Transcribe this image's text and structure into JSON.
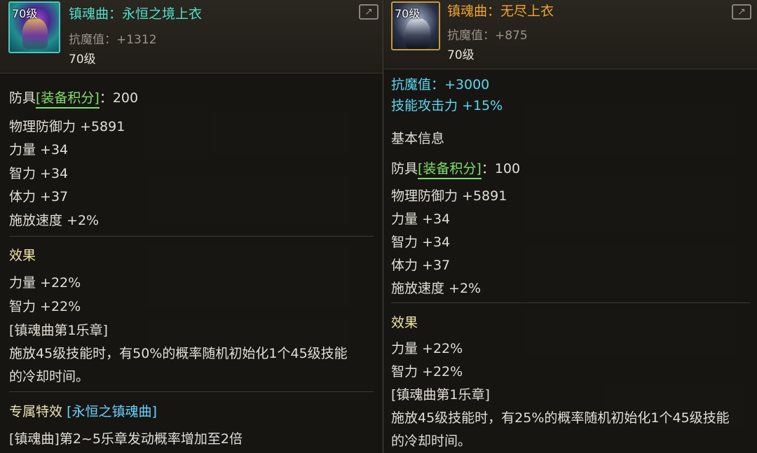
{
  "left": {
    "icon_level": "70级",
    "icon": "armor-icon",
    "title": "镇魂曲：永恒之境上衣",
    "magic_res": "抗魔值：+1312",
    "level": "70级",
    "armor_prefix": "防具",
    "score_label": "[装备积分]",
    "score_value": "：200",
    "stats": [
      "物理防御力 +5891",
      "力量 +34",
      "智力 +34",
      "体力 +37",
      "施放速度 +2%"
    ],
    "effect_title": "效果",
    "effects": [
      "力量 +22%",
      "智力 +22%",
      "[镇魂曲第1乐章]",
      "施放45级技能时，有50%的概率随机初始化1个45级技能",
      "的冷却时间。"
    ],
    "exclusive_title": "专属特效",
    "exclusive_name": "[永恒之镇魂曲]",
    "exclusive_desc": "[镇魂曲]第2~5乐章发动概率增加至2倍"
  },
  "right": {
    "icon_level": "70级",
    "icon": "armor-icon",
    "title": "镇魂曲：无尽上衣",
    "magic_res": "抗魔值：+875",
    "level": "70级",
    "bonus": [
      "抗魔值：+3000",
      "技能攻击力 +15%"
    ],
    "basic_info": "基本信息",
    "armor_prefix": "防具",
    "score_label": "[装备积分]",
    "score_value": "：100",
    "stats": [
      "物理防御力 +5891",
      "力量 +34",
      "智力 +34",
      "体力 +37",
      "施放速度 +2%"
    ],
    "effect_title": "效果",
    "effects": [
      "力量 +22%",
      "智力 +22%",
      "[镇魂曲第1乐章]",
      "施放45级技能时，有25%的概率随机初始化1个45级技能",
      "的冷却时间。"
    ]
  },
  "colors": {
    "legendary_title": "#4fe0c8",
    "epic_title": "#f0a331",
    "score_bracket": "#7fe06a",
    "bonus_blue": "#5ad7f0"
  }
}
